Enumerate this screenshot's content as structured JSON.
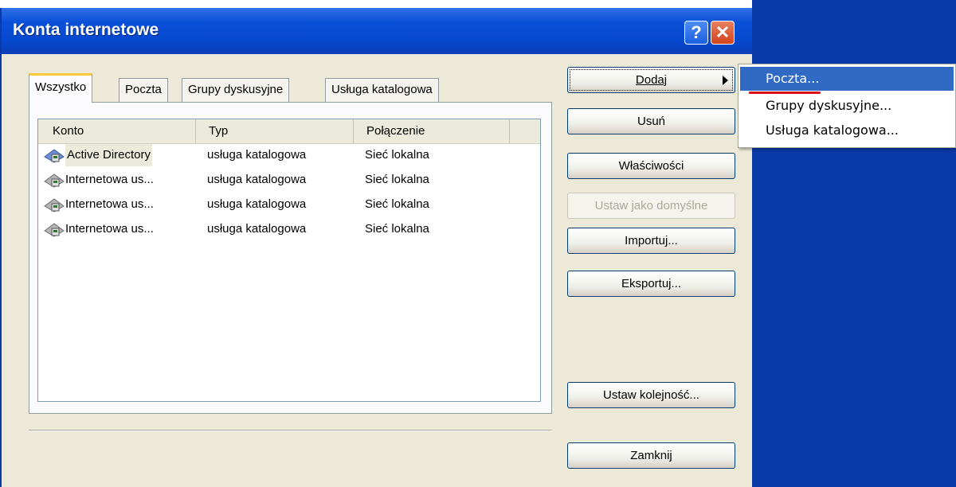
{
  "window": {
    "title": "Konta internetowe"
  },
  "titlebar_buttons": {
    "help": "?",
    "close": "✕"
  },
  "tabs": [
    "Wszystko",
    "Poczta",
    "Grupy dyskusyjne",
    "Usługa katalogowa"
  ],
  "list": {
    "columns": [
      "Konto",
      "Typ",
      "Połączenie"
    ],
    "rows": [
      {
        "konto": "Active Directory",
        "typ": "usługa katalogowa",
        "polaczenie": "Sieć lokalna"
      },
      {
        "konto": "Internetowa us...",
        "typ": "usługa katalogowa",
        "polaczenie": "Sieć lokalna"
      },
      {
        "konto": "Internetowa us...",
        "typ": "usługa katalogowa",
        "polaczenie": "Sieć lokalna"
      },
      {
        "konto": "Internetowa us...",
        "typ": "usługa katalogowa",
        "polaczenie": "Sieć lokalna"
      }
    ]
  },
  "buttons": {
    "dodaj": "Dodaj",
    "usun": "Usuń",
    "wlasciwosci": "Właściwości",
    "ustaw_domyslne": "Ustaw jako domyślne",
    "importuj": "Importuj...",
    "eksportuj": "Eksportuj...",
    "ustaw_kolejnosc": "Ustaw kolejność...",
    "zamknij": "Zamknij"
  },
  "menu": [
    "Poczta...",
    "Grupy dyskusyjne...",
    "Usługa katalogowa..."
  ],
  "colors": {
    "titlebar": "#0649cf",
    "desktop": "#0a3aa8",
    "menu_highlight": "#316ac5",
    "annotation": "#d9111d"
  }
}
